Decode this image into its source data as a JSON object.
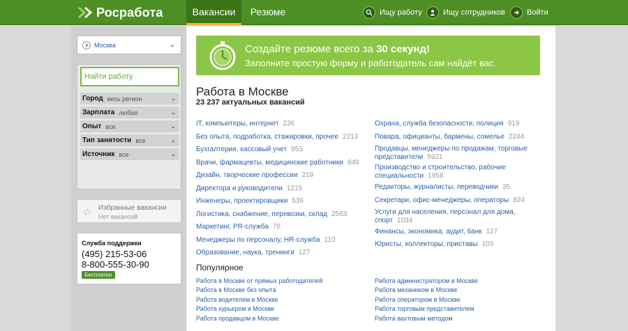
{
  "header": {
    "logo": "Росработа",
    "tabs": [
      {
        "label": "Вакансии",
        "active": true
      },
      {
        "label": "Резюме",
        "active": false
      }
    ],
    "links": [
      {
        "label": "Ищу работу",
        "icon": "search-icon"
      },
      {
        "label": "Ищу сотрудников",
        "icon": "people-icon"
      },
      {
        "label": "Войти",
        "icon": "arrow-right-icon"
      }
    ]
  },
  "sidebar": {
    "city": "Москва",
    "search_placeholder": "Найти работу",
    "filters": [
      {
        "label": "Город",
        "value": "весь регион"
      },
      {
        "label": "Зарплата",
        "value": "любая"
      },
      {
        "label": "Опыт",
        "value": "все"
      },
      {
        "label": "Тип занятости",
        "value": "все"
      },
      {
        "label": "Источник",
        "value": "все"
      }
    ],
    "favorites": {
      "title": "Избранные вакансии",
      "subtitle": "Нет вакансий"
    },
    "support": {
      "title": "Служба поддержки",
      "phone1": "(495) 215-53-06",
      "phone2": "8-800-555-30-90",
      "badge": "Бесплатно"
    }
  },
  "banner": {
    "line1_prefix": "Создайте резюме всего за ",
    "line1_bold": "30 секунд!",
    "line2": "Заполните простую форму и работодатель сам найдёт вас."
  },
  "main": {
    "title": "Работа в Москве",
    "subtitle": "23 237 актуальных вакансий",
    "categories_left": [
      {
        "name": "IT, компьютеры, интернет",
        "count": "236"
      },
      {
        "name": "Без опыта, подработка, стажировки, прочее",
        "count": "2213"
      },
      {
        "name": "Бухгалтерия, кассовый учет",
        "count": "953"
      },
      {
        "name": "Врачи, фармацевты, медицинские работники",
        "count": "949"
      },
      {
        "name": "Дизайн, творческие профессии",
        "count": "219"
      },
      {
        "name": "Директора и руководители",
        "count": "1215"
      },
      {
        "name": "Инженеры, проектировщики",
        "count": "536"
      },
      {
        "name": "Логистика, снабжение, перевозки, склад",
        "count": "2563"
      },
      {
        "name": "Маркетинг, PR-служба",
        "count": "76"
      },
      {
        "name": "Менеджеры по персоналу, HR-служба",
        "count": "110"
      },
      {
        "name": "Образование, наука, тренинги",
        "count": "127"
      }
    ],
    "categories_right": [
      {
        "name": "Охрана, служба безопасности, полиция",
        "count": "919"
      },
      {
        "name": "Повара, официанты, бармены, сомелье",
        "count": "2244"
      },
      {
        "name": "Продавцы, менеджеры по продажам, торговые представители",
        "count": "5921"
      },
      {
        "name": "Производство и строительство, рабочие специальности",
        "count": "1958"
      },
      {
        "name": "Редакторы, журналисты, переводчики",
        "count": "35"
      },
      {
        "name": "Секретари, офис-менеджеры, операторы",
        "count": "824"
      },
      {
        "name": "Услуги для населения, персонал для дома, спорт",
        "count": "1034"
      },
      {
        "name": "Финансы, экономика, аудит, банк",
        "count": "127"
      },
      {
        "name": "Юристы, коллекторы, приставы",
        "count": "103"
      }
    ],
    "popular_title": "Популярное",
    "popular_left": [
      "Работа в Москве от прямых работодателей",
      "Работа в Москве без опыта",
      "Работа водителем в Москве",
      "Работа курьером в Москве",
      "Работа продавцом в Москве"
    ],
    "popular_right": [
      "Работа администратором в Москве",
      "Работа механиком в Москве",
      "Работа оператором в Москве",
      "Работа торговым представителем",
      "Работа вахтовым методом"
    ]
  },
  "colors": {
    "brand_green": "#4d8f24",
    "banner_green": "#8cc646",
    "link_blue": "#2a5fa6",
    "accent_yellow": "#f0b32a"
  }
}
